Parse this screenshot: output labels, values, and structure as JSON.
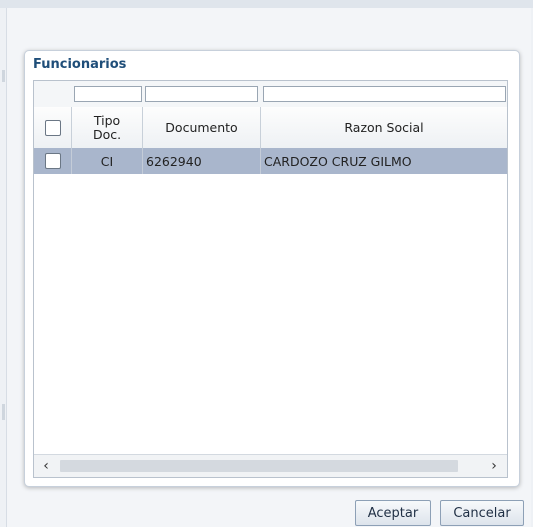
{
  "dialog": {
    "title": "Funcionarios",
    "table": {
      "columns": [
        {
          "key": "select",
          "label": ""
        },
        {
          "key": "tipo_doc",
          "label": "Tipo Doc."
        },
        {
          "key": "documento",
          "label": "Documento"
        },
        {
          "key": "razon_social",
          "label": "Razon Social"
        }
      ],
      "filters": {
        "tipo_doc": "",
        "documento": "",
        "razon_social": ""
      },
      "rows": [
        {
          "selected": false,
          "tipo_doc": "CI",
          "documento": "6262940",
          "razon_social": "CARDOZO CRUZ GILMO"
        }
      ],
      "scroll_left_icon": "chevron-left-icon",
      "scroll_right_icon": "chevron-right-icon"
    }
  },
  "buttons": {
    "accept": "Aceptar",
    "cancel": "Cancelar"
  },
  "colors": {
    "title": "#1f4e79",
    "selected_row": "#a9b6cc",
    "button_border": "#8da0b6"
  }
}
